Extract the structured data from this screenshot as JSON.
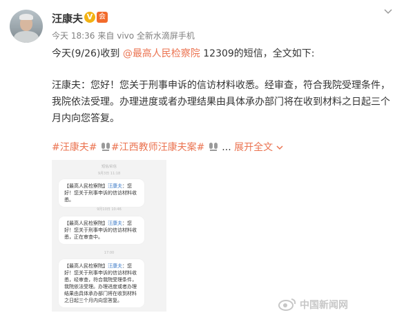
{
  "post": {
    "username": "汪康夫",
    "vip_badge": "V",
    "level_icon": "会",
    "time": "今天 18:36",
    "source": "来自 vivo 全新水滴屏手机",
    "line1_prefix": "今天(9/26)收到 ",
    "mention": "@最高人民检察院",
    "line1_suffix": " 12309的短信，全文如下:",
    "para2": "汪康夫：您好！您关于刑事申诉的信访材料收悉。经审查，符合我院受理条件，我院依法受理。办理进度或者办理结果由具体承办部门将在收到材料之日起三个月内向您答复。",
    "tag1": "#汪康夫#",
    "tag2": "#江西教师汪康夫案#",
    "ellipsis": "...",
    "expand": "展开全文"
  },
  "sms": {
    "sender": "短信/彩信",
    "time1": "9月3日 11:18",
    "msg1_prefix": "【最高人民检察院】",
    "msg1_name": "汪康夫",
    "msg1_text": "：您好！您关于刑事申诉的信访材料收悉。",
    "time2": "9月10日 10:46",
    "msg2_prefix": "【最高人民检察院】",
    "msg2_name": "汪康夫",
    "msg2_text": "：您好！您关于刑事申诉的信访材料收悉，正在审查中。",
    "time3": "17:00",
    "msg3_prefix": "【最高人民检察院】",
    "msg3_name": "汪康夫",
    "msg3_text": "：您好！您关于刑事申诉的信访材料收悉，经审查，符合我院受理条件，我院依法受理。办理进度或者办理结果由具体承办部门将在收到材料之日起三个月内向您答复。"
  },
  "watermark": "中国新闻网",
  "colors": {
    "link": "#eb7350",
    "vip": "#f3b213",
    "meta": "#808080"
  }
}
